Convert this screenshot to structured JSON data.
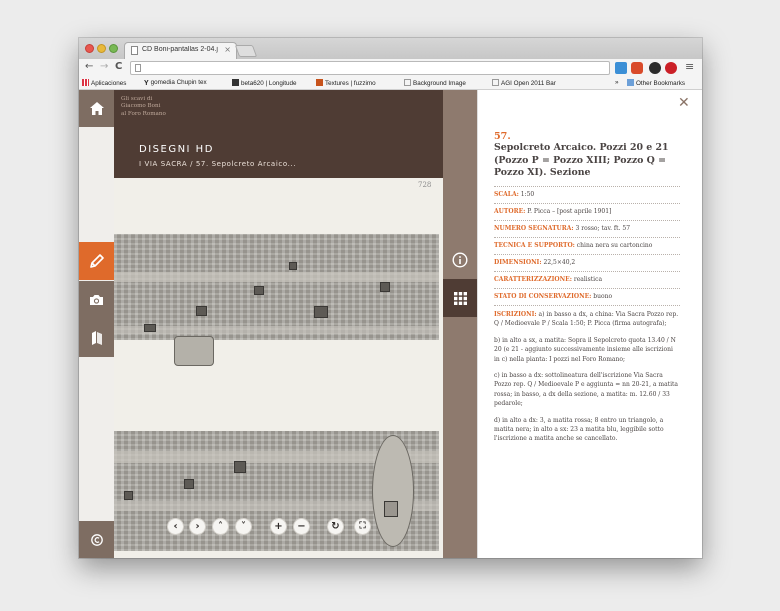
{
  "browser": {
    "tab_title": "CD Boni-pantallas 2-04.jp",
    "tab_close": "×",
    "back": "←",
    "forward": "→",
    "reload": "C",
    "url": "",
    "menu": "≡",
    "bookmarks": [
      {
        "label": "Aplicaciones",
        "icon": "apps-grid-icon"
      },
      {
        "label": "gomedia Chupin tex",
        "icon": "y-logo-icon"
      },
      {
        "label": "beta620 | Longitude",
        "icon": "longitude-icon"
      },
      {
        "label": "Textures | fuzzimo",
        "icon": "fuzzimo-icon"
      },
      {
        "label": "Background Image",
        "icon": "page-icon"
      },
      {
        "label": "AGI Open 2011 Bar",
        "icon": "page-icon"
      },
      {
        "label": "»",
        "icon": ""
      },
      {
        "label": "Other Bookmarks",
        "icon": "folder-icon"
      }
    ]
  },
  "site": {
    "brand_lines": [
      "Gli scavi di",
      "Giacomo Boni",
      "al Foro Romano"
    ],
    "section_title": "DISEGNI HD",
    "breadcrumb": "I VIA SACRA  /  57. Sepolcreto Arcaico...",
    "page_number": "728"
  },
  "viewer": {
    "controls": [
      {
        "name": "prev-button",
        "glyph": "‹"
      },
      {
        "name": "next-button",
        "glyph": "›"
      },
      {
        "name": "up-button",
        "glyph": "˄"
      },
      {
        "name": "down-button",
        "glyph": "˅"
      },
      {
        "name": "zoom-in-button",
        "glyph": "+"
      },
      {
        "name": "zoom-out-button",
        "glyph": "−"
      },
      {
        "name": "rotate-button",
        "glyph": "↻"
      },
      {
        "name": "fullscreen-button",
        "glyph": "⛶"
      }
    ]
  },
  "detail": {
    "close": "✕",
    "number": "57.",
    "title": "Sepolcreto Arcaico. Pozzi 20 e 21 (Pozzo P = Pozzo XIII; Pozzo Q = Pozzo XI). Sezione",
    "fields": [
      {
        "label": "SCALA:",
        "value": " 1:50"
      },
      {
        "label": "AUTORE:",
        "value": " P. Picca – [post aprile 1901]"
      },
      {
        "label": "NUMERO SEGNATURA:",
        "value": " 3 rosso; tav. ft. 57"
      },
      {
        "label": "TECNICA E SUPPORTO:",
        "value": " china nera su cartoncino"
      },
      {
        "label": "DIMENSIONI:",
        "value": " 22,5×40,2"
      },
      {
        "label": "CARATTERIZZAZIONE:",
        "value": " realistica"
      },
      {
        "label": "STATO DI CONSERVAZIONE:",
        "value": " buono"
      }
    ],
    "inscriptions_label": "ISCRIZIONI:",
    "inscriptions": [
      " a) in basso a dx, a china: Via Sacra Pozzo rep. Q / Medioevale P / Scala 1:50; P. Picca (firma autografa);",
      "b) in alto a sx, a matita: Sopra il Sepolcreto quota 13.40 / N 20 (e 21 - aggiunto successivamente insieme alle iscrizioni in c) nella pianta: I pozzi nel Foro Romano;",
      "c) in basso a dx: sottolineatura dell'iscrizione Via Sacra Pozzo rep. Q / Medioevale P e aggiunta = nn 20-21, a matita rossa; in basso, a dx della sezione, a matita: m. 12.60 / 33 pedarole;",
      "d) in alto a dx: 3, a matita rossa; 8 entro un triangolo, a matita nera; in alto a sx: 23 a matita blu, leggibile sotto l'iscrizione a matita anche se cancellato."
    ]
  },
  "colors": {
    "accent": "#df6a2b",
    "dark_brown": "#4f3c34",
    "mid_brown": "#7e6d62",
    "rightbar": "#8e7a6e"
  }
}
